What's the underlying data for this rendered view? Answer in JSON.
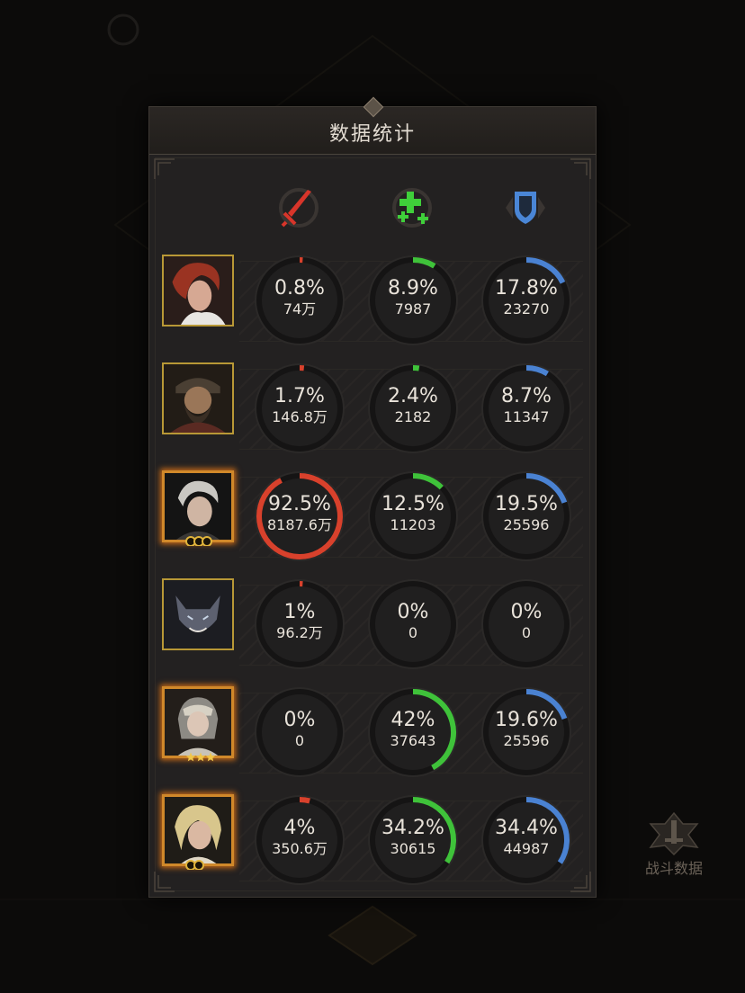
{
  "panel": {
    "title": "数据统计"
  },
  "stat_icons": [
    {
      "name": "sword-icon",
      "color": "#d8352a"
    },
    {
      "name": "heal-plus-icon",
      "color": "#3fcf3a"
    },
    {
      "name": "shield-icon",
      "color": "#4a86d6"
    }
  ],
  "colors": {
    "damage": "#d8412c",
    "heal": "#3fc23a",
    "shield": "#4a82d2",
    "track": "#151414"
  },
  "heroes": [
    {
      "name": "red-haired-hero",
      "damage": {
        "pct": "0.8%",
        "value": "74万",
        "ratio": 0.008
      },
      "heal": {
        "pct": "8.9%",
        "value": "7987",
        "ratio": 0.089
      },
      "shield": {
        "pct": "17.8%",
        "value": "23270",
        "ratio": 0.178
      }
    },
    {
      "name": "bearded-warrior",
      "damage": {
        "pct": "1.7%",
        "value": "146.8万",
        "ratio": 0.017
      },
      "heal": {
        "pct": "2.4%",
        "value": "2182",
        "ratio": 0.024
      },
      "shield": {
        "pct": "8.7%",
        "value": "11347",
        "ratio": 0.087
      }
    },
    {
      "name": "silver-haired-hero",
      "damage": {
        "pct": "92.5%",
        "value": "8187.6万",
        "ratio": 0.925
      },
      "heal": {
        "pct": "12.5%",
        "value": "11203",
        "ratio": 0.125
      },
      "shield": {
        "pct": "19.5%",
        "value": "25596",
        "ratio": 0.195
      }
    },
    {
      "name": "werewolf",
      "damage": {
        "pct": "1%",
        "value": "96.2万",
        "ratio": 0.01
      },
      "heal": {
        "pct": "0%",
        "value": "0",
        "ratio": 0
      },
      "shield": {
        "pct": "0%",
        "value": "0",
        "ratio": 0
      }
    },
    {
      "name": "masked-priestess",
      "damage": {
        "pct": "0%",
        "value": "0",
        "ratio": 0
      },
      "heal": {
        "pct": "42%",
        "value": "37643",
        "ratio": 0.42
      },
      "shield": {
        "pct": "19.6%",
        "value": "25596",
        "ratio": 0.196
      }
    },
    {
      "name": "blonde-elf",
      "damage": {
        "pct": "4%",
        "value": "350.6万",
        "ratio": 0.04
      },
      "heal": {
        "pct": "34.2%",
        "value": "30615",
        "ratio": 0.342
      },
      "shield": {
        "pct": "34.4%",
        "value": "44987",
        "ratio": 0.344
      }
    }
  ],
  "side_button": {
    "label": "战斗数据"
  }
}
